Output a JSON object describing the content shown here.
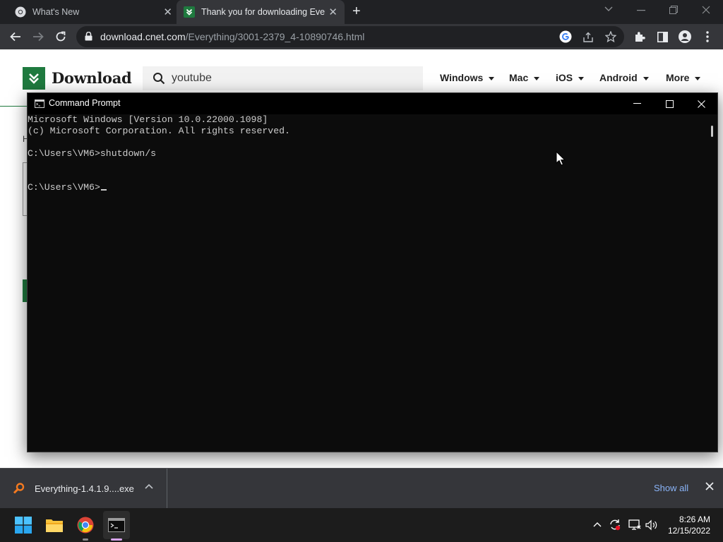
{
  "browser": {
    "tabs": [
      {
        "title": "What's New",
        "active": false
      },
      {
        "title": "Thank you for downloading Everything",
        "active": true
      }
    ],
    "address": {
      "domain": "download.cnet.com",
      "path": "/Everything/3001-2379_4-10890746.html"
    }
  },
  "page": {
    "brand": "Download",
    "search_query": "youtube",
    "nav": [
      "Windows",
      "Mac",
      "iOS",
      "Android",
      "More"
    ],
    "fragment_text": "H",
    "accent_color": "#1f7a3f"
  },
  "cmd": {
    "title": "Command Prompt",
    "lines": [
      "Microsoft Windows [Version 10.0.22000.1098]",
      "(c) Microsoft Corporation. All rights reserved.",
      "",
      "C:\\Users\\VM6>shutdown/s",
      "",
      "",
      "C:\\Users\\VM6>"
    ]
  },
  "downloads": {
    "file": "Everything-1.4.1.9....exe",
    "show_all": "Show all"
  },
  "taskbar": {
    "apps": [
      "start-icon",
      "file-explorer-icon",
      "chrome-icon",
      "command-prompt-icon"
    ],
    "time": "8:26 AM",
    "date": "12/15/2022"
  }
}
